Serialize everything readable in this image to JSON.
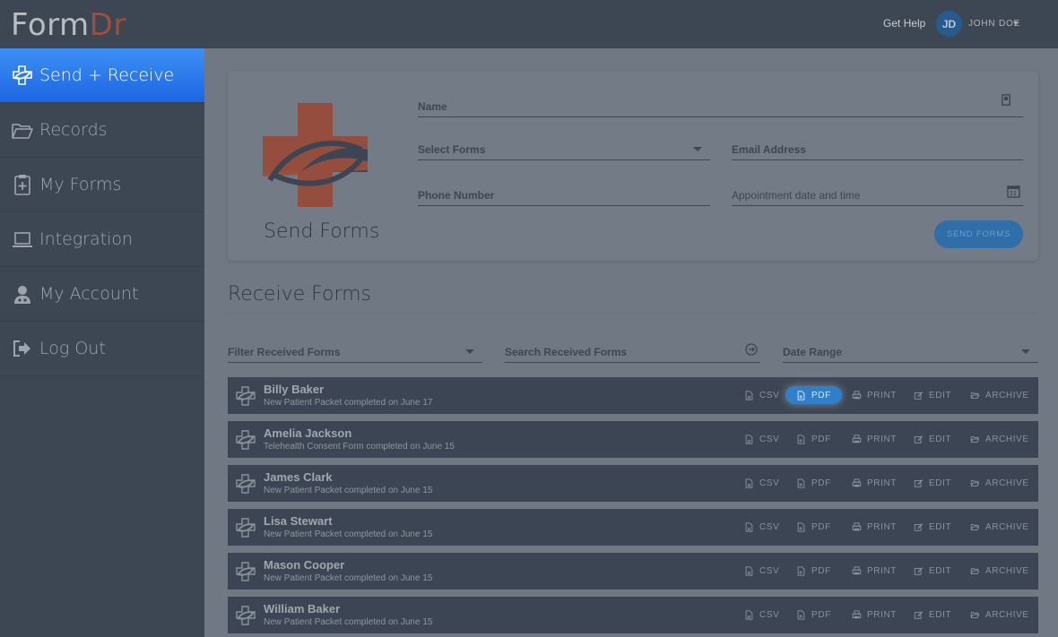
{
  "header": {
    "logo_part1": "Form",
    "logo_part2": "Dr",
    "get_help": "Get Help",
    "avatar_initials": "JD",
    "user_name": "JOHN DOE"
  },
  "sidebar": {
    "items": [
      {
        "label": "Send + Receive",
        "icon": "send-receive-icon",
        "active": true
      },
      {
        "label": "Records",
        "icon": "folder-icon"
      },
      {
        "label": "My Forms",
        "icon": "clipboard-plus-icon"
      },
      {
        "label": "Integration",
        "icon": "laptop-icon"
      },
      {
        "label": "My Account",
        "icon": "user-icon"
      },
      {
        "label": "Log Out",
        "icon": "logout-icon"
      }
    ]
  },
  "send": {
    "title": "Send Forms",
    "name_placeholder": "Name",
    "select_forms_placeholder": "Select Forms",
    "email_placeholder": "Email Address",
    "phone_placeholder": "Phone Number",
    "appointment_placeholder": "Appointment date and time",
    "button_label": "SEND FORMS"
  },
  "receive": {
    "title": "Receive Forms",
    "filter_placeholder": "Filter Received Forms",
    "search_placeholder": "Search Received Forms",
    "date_range_placeholder": "Date Range",
    "actions": {
      "csv": "CSV",
      "pdf": "PDF",
      "print": "PRINT",
      "edit": "EDIT",
      "archive": "ARCHIVE"
    },
    "rows": [
      {
        "name": "Billy Baker",
        "detail": "New Patient Packet completed on June 17"
      },
      {
        "name": "Amelia Jackson",
        "detail": "Telehealth Consent Form completed on June 15"
      },
      {
        "name": "James Clark",
        "detail": "New Patient Packet completed on June 15"
      },
      {
        "name": "Lisa Stewart",
        "detail": "New Patient Packet completed on June 15"
      },
      {
        "name": "Mason Cooper",
        "detail": "New Patient Packet completed on June 15"
      },
      {
        "name": "William Baker",
        "detail": "New Patient Packet completed on June 15"
      }
    ]
  },
  "colors": {
    "accent": "#2f7fcb",
    "sidebar_active": "#1c66e2",
    "logo_accent": "#9c4f3c"
  }
}
